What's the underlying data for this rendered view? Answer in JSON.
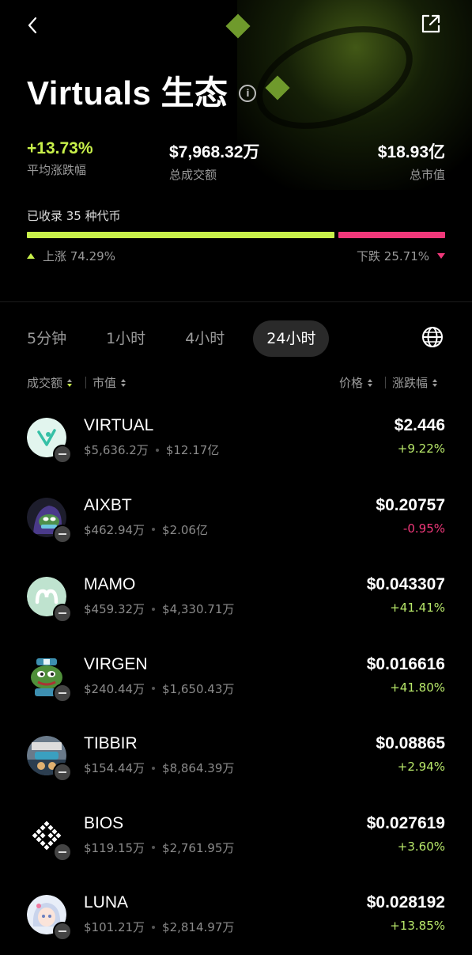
{
  "header": {
    "title": "Virtuals 生态",
    "back_icon": "chevron-left-icon",
    "share_icon": "external-link-icon",
    "info_icon": "info-icon"
  },
  "stats": [
    {
      "value": "+13.73%",
      "label": "平均涨跌幅"
    },
    {
      "value": "$7,968.32万",
      "label": "总成交额"
    },
    {
      "value": "$18.93亿",
      "label": "总市值"
    }
  ],
  "tracked": "已收录 35 种代币",
  "ratio": {
    "up_label": "上涨 74.29%",
    "down_label": "下跌 25.71%",
    "up_fraction": 0.7429,
    "down_fraction": 0.2571,
    "up_color": "#c8f04a",
    "down_color": "#f0387a"
  },
  "tabs": [
    {
      "label": "5分钟",
      "active": false
    },
    {
      "label": "1小时",
      "active": false
    },
    {
      "label": "4小时",
      "active": false
    },
    {
      "label": "24小时",
      "active": true
    }
  ],
  "sort": {
    "volume": "成交额",
    "market_cap": "市值",
    "price": "价格",
    "change": "涨跌幅"
  },
  "tokens": [
    {
      "symbol": "VIRTUAL",
      "volume": "$5,636.2万",
      "market_cap": "$12.17亿",
      "price": "$2.446",
      "change": "+9.22%",
      "direction": "up"
    },
    {
      "symbol": "AIXBT",
      "volume": "$462.94万",
      "market_cap": "$2.06亿",
      "price": "$0.20757",
      "change": "-0.95%",
      "direction": "down"
    },
    {
      "symbol": "MAMO",
      "volume": "$459.32万",
      "market_cap": "$4,330.71万",
      "price": "$0.043307",
      "change": "+41.41%",
      "direction": "up"
    },
    {
      "symbol": "VIRGEN",
      "volume": "$240.44万",
      "market_cap": "$1,650.43万",
      "price": "$0.016616",
      "change": "+41.80%",
      "direction": "up"
    },
    {
      "symbol": "TIBBIR",
      "volume": "$154.44万",
      "market_cap": "$8,864.39万",
      "price": "$0.08865",
      "change": "+2.94%",
      "direction": "up"
    },
    {
      "symbol": "BIOS",
      "volume": "$119.15万",
      "market_cap": "$2,761.95万",
      "price": "$0.027619",
      "change": "+3.60%",
      "direction": "up"
    },
    {
      "symbol": "LUNA",
      "volume": "$101.21万",
      "market_cap": "$2,814.97万",
      "price": "$0.028192",
      "change": "+13.85%",
      "direction": "up"
    }
  ]
}
